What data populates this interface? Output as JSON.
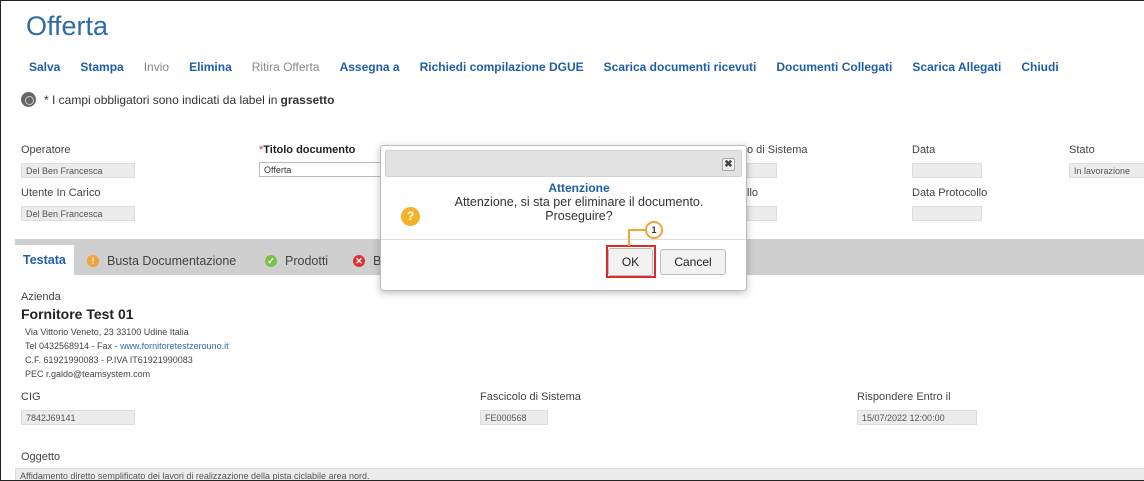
{
  "page": {
    "title": "Offerta"
  },
  "toolbar": [
    {
      "label": "Salva",
      "enabled": true
    },
    {
      "label": "Stampa",
      "enabled": true
    },
    {
      "label": "Invio",
      "enabled": false
    },
    {
      "label": "Elimina",
      "enabled": true
    },
    {
      "label": "Ritira Offerta",
      "enabled": false
    },
    {
      "label": "Assegna a",
      "enabled": true
    },
    {
      "label": "Richiedi compilazione DGUE",
      "enabled": true
    },
    {
      "label": "Scarica documenti ricevuti",
      "enabled": true
    },
    {
      "label": "Documenti Collegati",
      "enabled": true
    },
    {
      "label": "Scarica Allegati",
      "enabled": true
    },
    {
      "label": "Chiudi",
      "enabled": true
    }
  ],
  "note": {
    "prefix": "* I campi obbligatori sono indicati da label in",
    "bold": "grassetto"
  },
  "fields": {
    "operatore": {
      "label": "Operatore",
      "value": "Del Ben Francesca"
    },
    "titolo": {
      "label": "Titolo documento",
      "value": "Offerta"
    },
    "fascicolo_top": {
      "label": "o di Sistema",
      "value": ""
    },
    "data": {
      "label": "Data",
      "value": ""
    },
    "stato": {
      "label": "Stato",
      "value": "In lavorazione"
    },
    "utente": {
      "label": "Utente In Carico",
      "value": "Del Ben Francesca"
    },
    "protocollo": {
      "label": "llo",
      "value": ""
    },
    "data_protocollo": {
      "label": "Data Protocollo",
      "value": ""
    }
  },
  "tabs": [
    {
      "label": "Testata",
      "icon": "",
      "active": true
    },
    {
      "label": "Busta Documentazione",
      "icon": "warning-icon",
      "color": "#f2a33a"
    },
    {
      "label": "Prodotti",
      "icon": "check-icon",
      "color": "#7cc04a"
    },
    {
      "label": "B",
      "icon": "error-icon",
      "color": "#d33"
    }
  ],
  "azienda": {
    "label": "Azienda",
    "name": "Fornitore Test 01",
    "address": "Via Vittorio Veneto, 23 33100 Udine Italia",
    "contact_prefix": "Tel 0432568914 - Fax - ",
    "website": "www.fornitoretestzerouno.it",
    "tax": "C.F. 61921990083 - P.IVA IT61921990083",
    "pec": "PEC r.galdo@teamsystem.com"
  },
  "details": {
    "cig": {
      "label": "CIG",
      "value": "7842J69141"
    },
    "fascicolo": {
      "label": "Fascicolo di Sistema",
      "value": "FE000568"
    },
    "rispondere": {
      "label": "Rispondere Entro il",
      "value": "15/07/2022 12:00:00"
    },
    "oggetto": {
      "label": "Oggetto",
      "value": "Affidamento diretto semplificato dei lavori di realizzazione della pista ciclabile area nord."
    }
  },
  "dialog": {
    "title": "Attenzione",
    "message_line1": "Attenzione, si sta per eliminare il documento.",
    "message_line2": "Proseguire?",
    "ok_label": "OK",
    "cancel_label": "Cancel",
    "close_symbol": "✖",
    "icon_symbol": "?"
  },
  "callout": {
    "number": "1"
  },
  "colors": {
    "accent": "#1e5fa8",
    "title": "#2f6aa8",
    "highlight": "#d82b2b",
    "callout": "#f2a33a"
  }
}
